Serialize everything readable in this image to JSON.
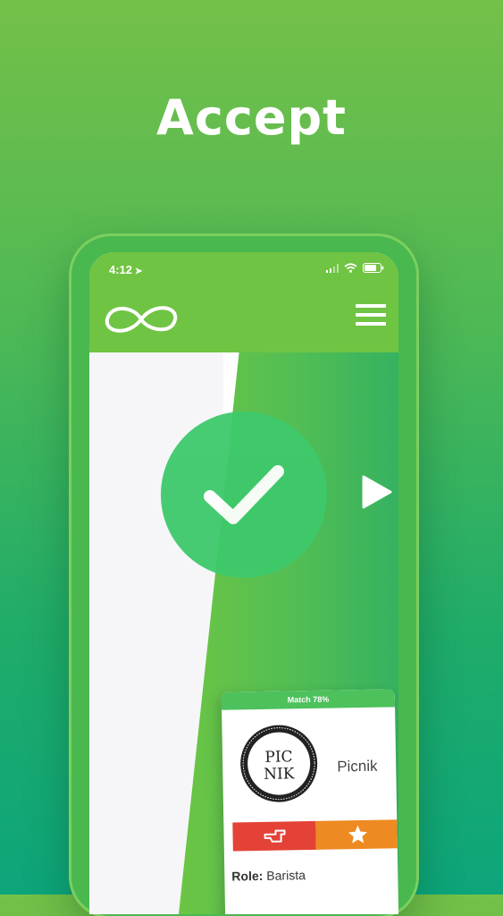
{
  "headline": "Accept",
  "status_bar": {
    "time": "4:12",
    "location_icon": "location-arrow-icon"
  },
  "nav": {
    "logo_icon": "infinity-logo-icon",
    "menu_icon": "hamburger-menu-icon"
  },
  "swipe": {
    "action_icon": "checkmark-icon",
    "next_icon": "play-arrow-icon"
  },
  "card": {
    "match": "Match 78%",
    "logo_text_top": "PIC",
    "logo_text_bottom": "NIK",
    "company_name": "Picnik",
    "reject_icon": "hand-pointing-icon",
    "favorite_icon": "star-icon",
    "role_label": "Role:",
    "role_value": "Barista"
  },
  "colors": {
    "brand_green": "#70c443",
    "accept_green": "#3ec96b",
    "reject_red": "#e44236",
    "favorite_orange": "#ed8a22"
  }
}
